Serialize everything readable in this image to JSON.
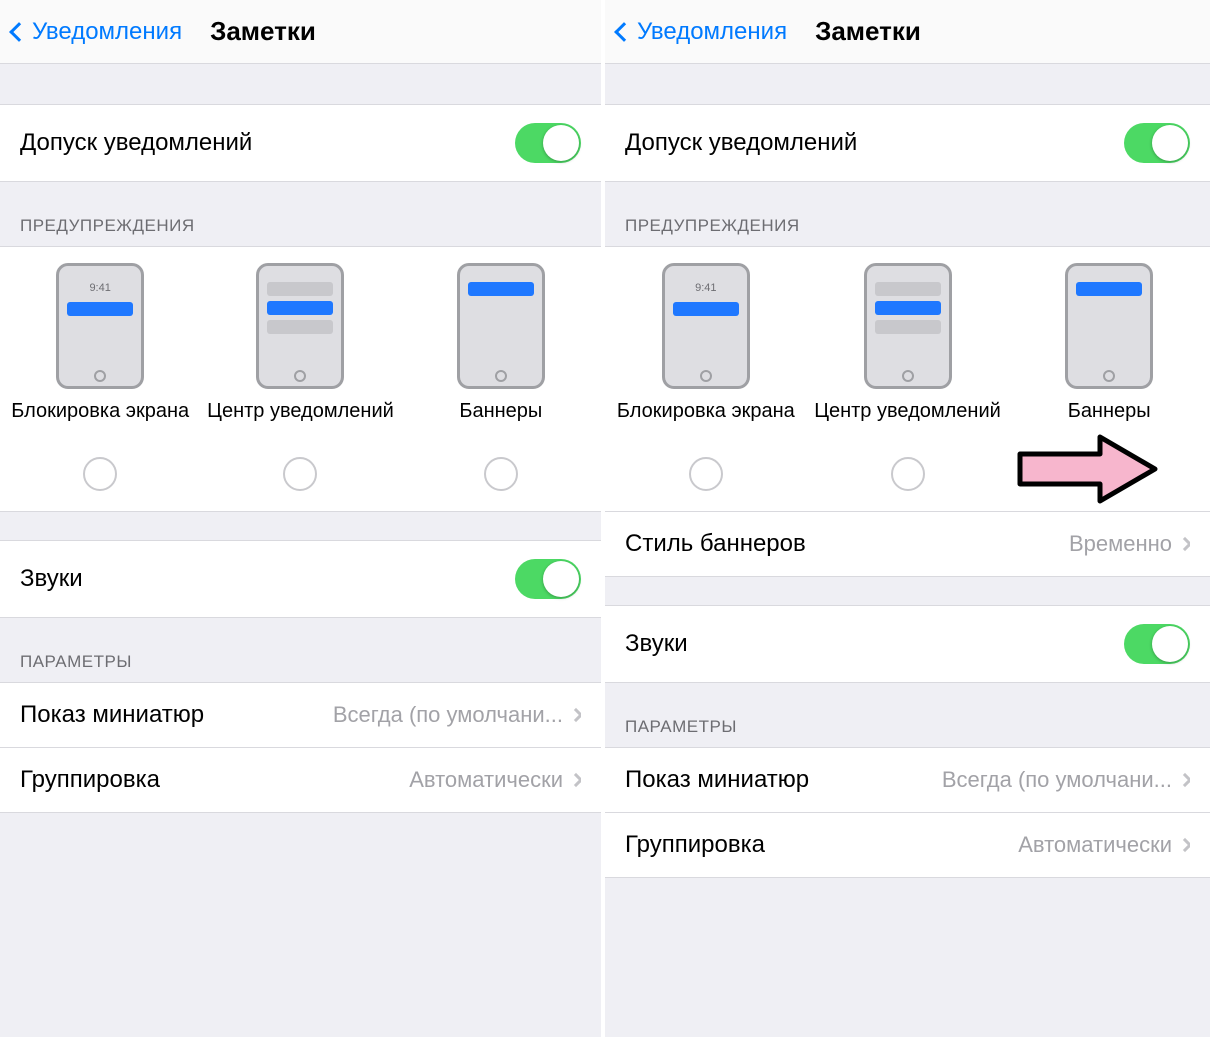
{
  "nav": {
    "back_label": "Уведомления",
    "title": "Заметки"
  },
  "allow": {
    "label": "Допуск уведомлений",
    "on": true
  },
  "alerts_header": "ПРЕДУПРЕЖДЕНИЯ",
  "alerts": {
    "lock": {
      "label": "Блокировка экрана",
      "time": "9:41"
    },
    "center": {
      "label": "Центр уведомлений"
    },
    "banners": {
      "label": "Баннеры"
    }
  },
  "banner_style": {
    "label": "Стиль баннеров",
    "value": "Временно"
  },
  "sounds": {
    "label": "Звуки",
    "on": true
  },
  "options_header": "ПАРАМЕТРЫ",
  "previews": {
    "label": "Показ миниатюр",
    "value": "Всегда (по умолчани..."
  },
  "grouping": {
    "label": "Группировка",
    "value": "Автоматически"
  },
  "right_pane": {
    "banners_checked": true
  }
}
